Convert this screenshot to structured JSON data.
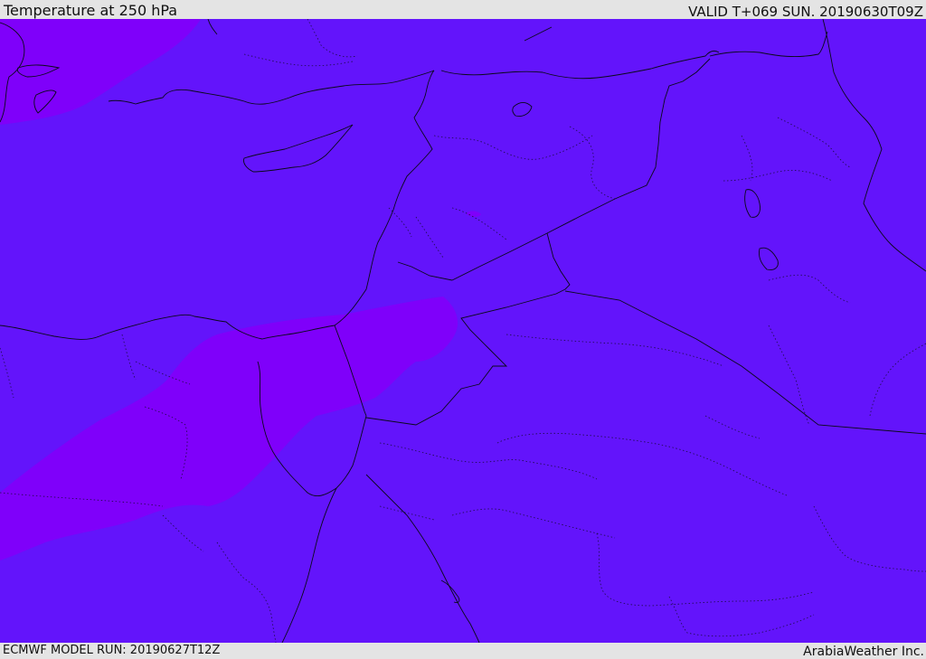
{
  "header": {
    "title": "Temperature at 250 hPa",
    "valid_time": "VALID T+069 SUN. 20190630T09Z"
  },
  "footer": {
    "model_run": "ECMWF MODEL RUN: 20190627T12Z",
    "credit": "ArabiaWeather Inc."
  },
  "map": {
    "colors": {
      "field_main": "#6314fb",
      "field_warm": "#7f00fa",
      "coastline": "#0a0a1a",
      "border": "#0a0a1a"
    }
  }
}
